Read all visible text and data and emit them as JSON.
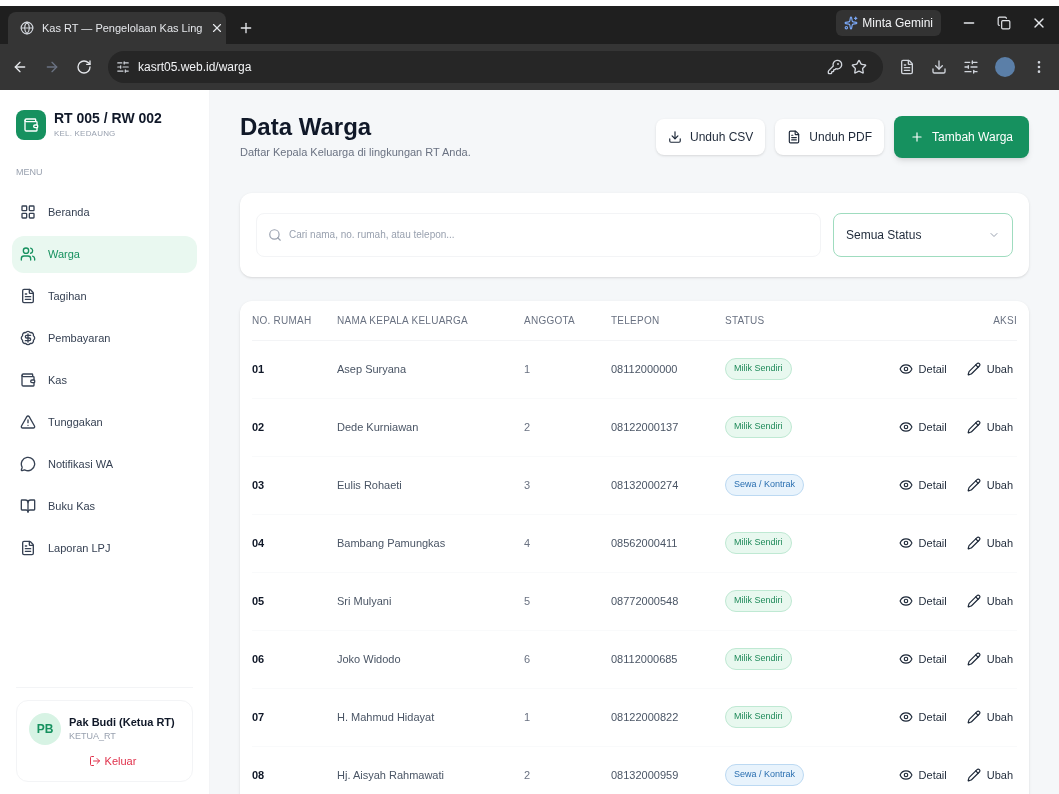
{
  "browser": {
    "tab_title": "Kas RT — Pengelolaan Kas Ling",
    "url": "kasrt05.web.id/warga",
    "assistant_button": "Minta Gemini"
  },
  "sidebar": {
    "org_name": "RT 005 / RW 002",
    "org_sub": "KEL. KEDAUNG",
    "menu_label": "MENU",
    "items": [
      {
        "label": "Beranda",
        "selected": false
      },
      {
        "label": "Warga",
        "selected": true
      },
      {
        "label": "Tagihan",
        "selected": false
      },
      {
        "label": "Pembayaran",
        "selected": false
      },
      {
        "label": "Kas",
        "selected": false
      },
      {
        "label": "Tunggakan",
        "selected": false
      },
      {
        "label": "Notifikasi WA",
        "selected": false
      },
      {
        "label": "Buku Kas",
        "selected": false
      },
      {
        "label": "Laporan LPJ",
        "selected": false
      }
    ],
    "user": {
      "initials": "PB",
      "name": "Pak Budi (Ketua RT)",
      "role": "KETUA_RT",
      "logout": "Keluar"
    }
  },
  "page": {
    "title": "Data Warga",
    "subtitle": "Daftar Kepala Keluarga di lingkungan RT Anda.",
    "buttons": [
      {
        "label": "Unduh CSV",
        "kind": "csv"
      },
      {
        "label": "Unduh PDF",
        "kind": "pdf"
      },
      {
        "label": "Tambah Warga",
        "kind": "primary"
      }
    ],
    "search": {
      "placeholder": "Cari nama, no. rumah, atau telepon..."
    },
    "status_filter": "Semua Status"
  },
  "table": {
    "columns": [
      "NO. RUMAH",
      "NAMA KEPALA KELUARGA",
      "ANGGOTA",
      "TELEPON",
      "STATUS",
      "AKSI"
    ],
    "rows": [
      {
        "no": "01",
        "name": "Asep Suryana",
        "members": "1",
        "phone": "08112000000",
        "status": {
          "label": "Milik Sendiri",
          "kind": "owned"
        },
        "actions": [
          "Detail",
          "Ubah"
        ]
      },
      {
        "no": "02",
        "name": "Dede Kurniawan",
        "members": "2",
        "phone": "08122000137",
        "status": {
          "label": "Milik Sendiri",
          "kind": "owned"
        },
        "actions": [
          "Detail",
          "Ubah"
        ]
      },
      {
        "no": "03",
        "name": "Eulis Rohaeti",
        "members": "3",
        "phone": "08132000274",
        "status": {
          "label": "Sewa / Kontrak",
          "kind": "rented"
        },
        "actions": [
          "Detail",
          "Ubah"
        ]
      },
      {
        "no": "04",
        "name": "Bambang Pamungkas",
        "members": "4",
        "phone": "08562000411",
        "status": {
          "label": "Milik Sendiri",
          "kind": "owned"
        },
        "actions": [
          "Detail",
          "Ubah"
        ]
      },
      {
        "no": "05",
        "name": "Sri Mulyani",
        "members": "5",
        "phone": "08772000548",
        "status": {
          "label": "Milik Sendiri",
          "kind": "owned"
        },
        "actions": [
          "Detail",
          "Ubah"
        ]
      },
      {
        "no": "06",
        "name": "Joko Widodo",
        "members": "6",
        "phone": "08112000685",
        "status": {
          "label": "Milik Sendiri",
          "kind": "owned"
        },
        "actions": [
          "Detail",
          "Ubah"
        ]
      },
      {
        "no": "07",
        "name": "H. Mahmud Hidayat",
        "members": "1",
        "phone": "08122000822",
        "status": {
          "label": "Milik Sendiri",
          "kind": "owned"
        },
        "actions": [
          "Detail",
          "Ubah"
        ]
      },
      {
        "no": "08",
        "name": "Hj. Aisyah Rahmawati",
        "members": "2",
        "phone": "08132000959",
        "status": {
          "label": "Sewa / Kontrak",
          "kind": "rented"
        },
        "actions": [
          "Detail",
          "Ubah"
        ]
      }
    ]
  }
}
